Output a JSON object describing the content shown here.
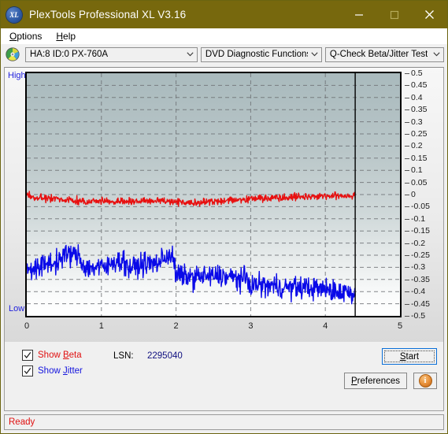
{
  "window": {
    "title": "PlexTools Professional XL V3.16",
    "icon_name": "plextools-xl-logo",
    "accent_color": "#77680d",
    "minimize_label": "Minimize",
    "maximize_label": "Maximize",
    "close_label": "Close"
  },
  "menu": {
    "items": [
      {
        "label": "Options",
        "accel": "O"
      },
      {
        "label": "Help",
        "accel": "H"
      }
    ]
  },
  "toolbar": {
    "disc_icon": "optical-disc-icon",
    "drive_select": {
      "value": "HA:8 ID:0  PX-760A",
      "options": [
        "HA:8 ID:0  PX-760A"
      ]
    },
    "function_select": {
      "value": "DVD Diagnostic Functions",
      "options": [
        "DVD Diagnostic Functions"
      ]
    },
    "test_select": {
      "value": "Q-Check Beta/Jitter Test",
      "options": [
        "Q-Check Beta/Jitter Test"
      ]
    }
  },
  "chart_labels": {
    "high": "High",
    "low": "Low"
  },
  "controls": {
    "show_beta": {
      "label": "Show Beta",
      "accel": "B",
      "checked": true,
      "color": "#e01010"
    },
    "show_jitter": {
      "label": "Show Jitter",
      "accel": "J",
      "checked": true,
      "color": "#1414dd"
    },
    "lsn_label": "LSN:",
    "lsn_value": "2295040",
    "start_button": {
      "label": "Start",
      "accel": "S"
    },
    "preferences_button": {
      "label": "Preferences",
      "accel": "P"
    },
    "info_button": {
      "label": "i",
      "icon": "info-icon"
    }
  },
  "status": {
    "text": "Ready"
  },
  "chart_data": {
    "type": "line",
    "title": "Q-Check Beta/Jitter Test",
    "xlabel": "",
    "ylabel": "",
    "xlim": [
      0,
      5
    ],
    "ylim": [
      -0.5,
      0.5
    ],
    "xticks": [
      0,
      1,
      2,
      3,
      4,
      5
    ],
    "yticks": [
      0.5,
      0.45,
      0.4,
      0.35,
      0.3,
      0.25,
      0.2,
      0.15,
      0.1,
      0.05,
      0,
      -0.05,
      -0.1,
      -0.15,
      -0.2,
      -0.25,
      -0.3,
      -0.35,
      -0.4,
      -0.45,
      -0.5
    ],
    "ytick_labels": [
      "0.5",
      "0.45",
      "0.4",
      "0.35",
      "0.3",
      "0.25",
      "0.2",
      "0.15",
      "0.1",
      "0.05",
      "0",
      "-0.05",
      "-0.1",
      "-0.15",
      "-0.2",
      "-0.25",
      "-0.3",
      "-0.35",
      "-0.4",
      "-0.45",
      "-0.5"
    ],
    "grid": true,
    "legend": "none",
    "data_end_x": 4.4,
    "series": [
      {
        "name": "Beta",
        "color": "#e81010",
        "x": [
          0.0,
          0.05,
          0.1,
          0.15,
          0.2,
          0.25,
          0.3,
          0.35,
          0.4,
          0.45,
          0.5,
          0.55,
          0.6,
          0.65,
          0.7,
          0.75,
          0.8,
          0.85,
          0.9,
          0.95,
          1.0,
          1.05,
          1.1,
          1.15,
          1.2,
          1.25,
          1.3,
          1.35,
          1.4,
          1.45,
          1.5,
          1.55,
          1.6,
          1.65,
          1.7,
          1.75,
          1.8,
          1.85,
          1.9,
          1.95,
          2.0,
          2.05,
          2.1,
          2.15,
          2.2,
          2.25,
          2.3,
          2.35,
          2.4,
          2.45,
          2.5,
          2.55,
          2.6,
          2.65,
          2.7,
          2.75,
          2.8,
          2.85,
          2.9,
          2.95,
          3.0,
          3.05,
          3.1,
          3.15,
          3.2,
          3.25,
          3.3,
          3.35,
          3.4,
          3.45,
          3.5,
          3.55,
          3.6,
          3.65,
          3.7,
          3.75,
          3.8,
          3.85,
          3.9,
          3.95,
          4.0,
          4.05,
          4.1,
          4.15,
          4.2,
          4.25,
          4.3,
          4.35,
          4.4
        ],
        "y": [
          0.002,
          -0.004,
          -0.01,
          -0.014,
          -0.016,
          -0.018,
          -0.019,
          -0.02,
          -0.02,
          -0.021,
          -0.021,
          -0.022,
          -0.022,
          -0.024,
          -0.026,
          -0.027,
          -0.028,
          -0.027,
          -0.026,
          -0.026,
          -0.027,
          -0.028,
          -0.029,
          -0.03,
          -0.031,
          -0.031,
          -0.03,
          -0.029,
          -0.029,
          -0.028,
          -0.028,
          -0.028,
          -0.027,
          -0.027,
          -0.026,
          -0.026,
          -0.026,
          -0.026,
          -0.027,
          -0.028,
          -0.029,
          -0.03,
          -0.031,
          -0.032,
          -0.032,
          -0.032,
          -0.031,
          -0.031,
          -0.03,
          -0.029,
          -0.028,
          -0.027,
          -0.026,
          -0.025,
          -0.024,
          -0.023,
          -0.022,
          -0.021,
          -0.02,
          -0.019,
          -0.018,
          -0.017,
          -0.016,
          -0.015,
          -0.014,
          -0.013,
          -0.012,
          -0.012,
          -0.011,
          -0.011,
          -0.01,
          -0.01,
          -0.009,
          -0.009,
          -0.008,
          -0.008,
          -0.008,
          -0.007,
          -0.007,
          -0.007,
          -0.006,
          -0.006,
          -0.006,
          -0.006,
          -0.005,
          -0.005,
          -0.005,
          -0.005,
          -0.005
        ],
        "noise": 0.01
      },
      {
        "name": "Jitter",
        "color": "#0a0ae8",
        "x": [
          0.0,
          0.05,
          0.1,
          0.15,
          0.2,
          0.25,
          0.3,
          0.35,
          0.4,
          0.45,
          0.5,
          0.55,
          0.6,
          0.65,
          0.7,
          0.75,
          0.8,
          0.85,
          0.9,
          0.95,
          1.0,
          1.05,
          1.1,
          1.15,
          1.2,
          1.25,
          1.3,
          1.35,
          1.4,
          1.45,
          1.5,
          1.55,
          1.6,
          1.65,
          1.7,
          1.75,
          1.8,
          1.85,
          1.9,
          1.95,
          2.0,
          2.05,
          2.1,
          2.15,
          2.2,
          2.25,
          2.3,
          2.35,
          2.4,
          2.45,
          2.5,
          2.55,
          2.6,
          2.65,
          2.7,
          2.75,
          2.8,
          2.85,
          2.9,
          2.95,
          3.0,
          3.05,
          3.1,
          3.15,
          3.2,
          3.25,
          3.3,
          3.35,
          3.4,
          3.45,
          3.5,
          3.55,
          3.6,
          3.65,
          3.7,
          3.75,
          3.8,
          3.85,
          3.9,
          3.95,
          4.0,
          4.05,
          4.1,
          4.15,
          4.2,
          4.25,
          4.3,
          4.35,
          4.4
        ],
        "y": [
          -0.3,
          -0.305,
          -0.3,
          -0.31,
          -0.295,
          -0.285,
          -0.28,
          -0.285,
          -0.28,
          -0.265,
          -0.25,
          -0.248,
          -0.247,
          -0.25,
          -0.252,
          -0.29,
          -0.3,
          -0.302,
          -0.3,
          -0.298,
          -0.3,
          -0.302,
          -0.3,
          -0.275,
          -0.272,
          -0.274,
          -0.272,
          -0.3,
          -0.302,
          -0.298,
          -0.292,
          -0.288,
          -0.286,
          -0.284,
          -0.286,
          -0.284,
          -0.27,
          -0.258,
          -0.248,
          -0.252,
          -0.33,
          -0.334,
          -0.336,
          -0.338,
          -0.34,
          -0.34,
          -0.338,
          -0.336,
          -0.338,
          -0.34,
          -0.336,
          -0.334,
          -0.336,
          -0.338,
          -0.34,
          -0.342,
          -0.344,
          -0.346,
          -0.348,
          -0.35,
          -0.372,
          -0.374,
          -0.372,
          -0.374,
          -0.376,
          -0.378,
          -0.376,
          -0.378,
          -0.38,
          -0.382,
          -0.384,
          -0.382,
          -0.384,
          -0.386,
          -0.384,
          -0.382,
          -0.384,
          -0.386,
          -0.388,
          -0.39,
          -0.392,
          -0.394,
          -0.396,
          -0.398,
          -0.4,
          -0.402,
          -0.4,
          -0.404,
          -0.406
        ],
        "noise": 0.03
      }
    ]
  }
}
